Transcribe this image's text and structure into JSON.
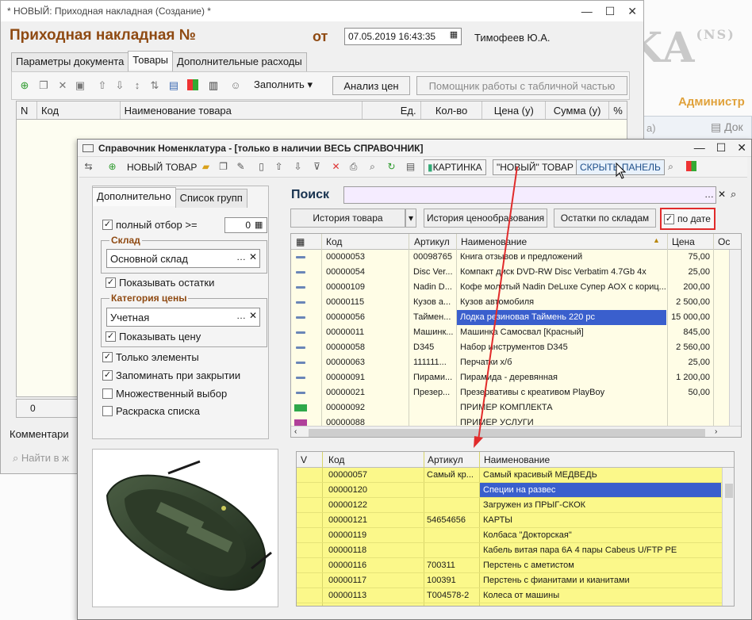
{
  "background": {
    "logo_text": "KA",
    "logo_sup": "(NS)",
    "admin_label": "Администр",
    "doc_label": "Док",
    "panel_text": "а)"
  },
  "main_window": {
    "title": "* НОВЫЙ: Приходная накладная (Создание) *",
    "heading": "Приходная накладная №",
    "from_label": "от",
    "date_value": "07.05.2019 16:43:35",
    "author": "Тимофеев Ю.А.",
    "tabs": [
      "Параметры документа",
      "Товары",
      "Дополнительные расходы"
    ],
    "fill_label": "Заполнить",
    "price_analysis_button": "Анализ цен",
    "table_helper_button": "Помощник работы с табличной частью",
    "columns": [
      "N",
      "Код",
      "Наименование товара",
      "Ед.",
      "Кол-во",
      "Цена (у)",
      "Сумма (у)",
      "%"
    ],
    "footer_total": "0",
    "comment_label": "Комментари",
    "find_label": "Найти в ж"
  },
  "ref_window": {
    "title": "Справочник Номенклатура - [только в наличии ВЕСЬ СПРАВОЧНИК]",
    "toolbar": {
      "new_item": "НОВЫЙ ТОВАР",
      "picture": "КАРТИНКА",
      "new_item_quoted": "\"НОВЫЙ\" ТОВАР",
      "hide_panel": "СКРЫТЬ ПАНЕЛЬ"
    },
    "left_tabs": [
      "Дополнительно",
      "Список групп"
    ],
    "full_select_label": "полный отбор >=",
    "full_select_value": "0",
    "warehouse_group": "Склад",
    "warehouse_value": "Основной склад",
    "show_stock": "Показывать остатки",
    "price_category_group": "Категория цены",
    "price_category_value": "Учетная",
    "show_price": "Показывать цену",
    "only_items": "Только элементы",
    "remember_on_close": "Запоминать при закрытии",
    "multi_select": "Множественный выбор",
    "color_list": "Раскраска списка",
    "search_label": "Поиск",
    "search_value": "",
    "buttons": {
      "item_history": "История товара",
      "price_history": "История ценообразования",
      "stock_by_warehouse": "Остатки по складам",
      "by_date": "по дате"
    },
    "top_grid": {
      "columns": [
        "Код",
        "Артикул",
        "Наименование",
        "Цена",
        "Ос"
      ],
      "rows": [
        {
          "code": "00000053",
          "article": "00098765",
          "name": "Книга отзывов и предложений",
          "price": "75,00"
        },
        {
          "code": "00000054",
          "article": "Disc Ver...",
          "name": "Компакт диск DVD-RW Disc Verbatim 4.7Gb 4x",
          "price": "25,00"
        },
        {
          "code": "00000109",
          "article": "Nadin D...",
          "name": "Кофе молотый Nadin DeLuxe Супер AOX с кориц...",
          "price": "200,00"
        },
        {
          "code": "00000115",
          "article": "Кузов а...",
          "name": "Кузов автомобиля",
          "price": "2 500,00"
        },
        {
          "code": "00000056",
          "article": "Таймен...",
          "name": "Лодка резиновая Таймень 220 pc",
          "price": "15 000,00"
        },
        {
          "code": "00000011",
          "article": "Машинк...",
          "name": "Машинка Самосвал [Красный]",
          "price": "845,00"
        },
        {
          "code": "00000058",
          "article": "D345",
          "name": "Набор инструментов D345",
          "price": "2 560,00"
        },
        {
          "code": "00000063",
          "article": "111111...",
          "name": "Перчатки х/б",
          "price": "25,00"
        },
        {
          "code": "00000091",
          "article": "Пирами...",
          "name": "Пирамида - деревянная",
          "price": "1 200,00"
        },
        {
          "code": "00000021",
          "article": "Презер...",
          "name": "Презервативы с креативом PlayBoy",
          "price": "50,00"
        },
        {
          "code": "00000092",
          "article": "",
          "name": "ПРИМЕР КОМПЛЕКТА",
          "price": ""
        },
        {
          "code": "00000088",
          "article": "",
          "name": "ПРИМЕР УСЛУГИ",
          "price": ""
        }
      ]
    },
    "bottom_grid": {
      "columns": [
        "V",
        "Код",
        "Артикул",
        "Наименование"
      ],
      "rows": [
        {
          "code": "00000057",
          "article": "Самый кр...",
          "name": "Самый красивый МЕДВЕДЬ"
        },
        {
          "code": "00000120",
          "article": "",
          "name": "Специи на развес"
        },
        {
          "code": "00000122",
          "article": "",
          "name": "Загружен из ПРЫГ-СКОК"
        },
        {
          "code": "00000121",
          "article": "54654656",
          "name": "КАРТЫ"
        },
        {
          "code": "00000119",
          "article": "",
          "name": "Колбаса \"Докторская\""
        },
        {
          "code": "00000118",
          "article": "",
          "name": "Кабель витая пара 6А 4 пары Cabeus U/FTP PE"
        },
        {
          "code": "00000116",
          "article": "700311",
          "name": "Перстень с аметистом"
        },
        {
          "code": "00000117",
          "article": "100391",
          "name": "Перстень с фианитами и кианитами"
        },
        {
          "code": "00000113",
          "article": "T004578-2",
          "name": "Колеса от машины"
        }
      ]
    }
  },
  "colors": {
    "heading": "#8f4a12",
    "selection": "#3a5fcd",
    "bottom_grid_bg": "#fbf88a",
    "search_bg": "#f5ecff",
    "arrow": "#e12b2b"
  }
}
